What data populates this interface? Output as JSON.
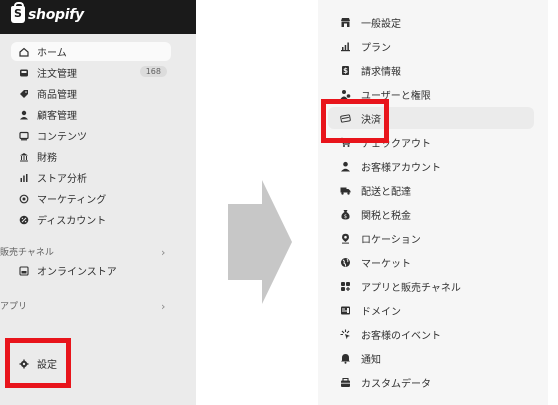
{
  "left_panel": {
    "brand": "shopify",
    "nav": [
      {
        "label": "ホーム",
        "icon": "home-icon"
      },
      {
        "label": "注文管理",
        "icon": "inbox-icon",
        "badge": "168"
      },
      {
        "label": "商品管理",
        "icon": "tag-icon"
      },
      {
        "label": "顧客管理",
        "icon": "person-icon"
      },
      {
        "label": "コンテンツ",
        "icon": "image-icon"
      },
      {
        "label": "財務",
        "icon": "bank-icon"
      },
      {
        "label": "ストア分析",
        "icon": "bar-chart-icon"
      },
      {
        "label": "マーケティング",
        "icon": "target-icon"
      },
      {
        "label": "ディスカウント",
        "icon": "discount-icon"
      }
    ],
    "sales_channels_label": "販売チャネル",
    "online_store_label": "オンラインストア",
    "apps_label": "アプリ",
    "settings_label": "設定"
  },
  "right_panel": {
    "items": [
      {
        "label": "一般設定",
        "icon": "store-icon"
      },
      {
        "label": "プラン",
        "icon": "plan-chart-icon"
      },
      {
        "label": "請求情報",
        "icon": "billing-icon"
      },
      {
        "label": "ユーザーと権限",
        "icon": "users-icon"
      },
      {
        "label": "決済",
        "icon": "payment-icon"
      },
      {
        "label": "チェックアウト",
        "icon": "cart-icon"
      },
      {
        "label": "お客様アカウント",
        "icon": "person-icon"
      },
      {
        "label": "配送と配達",
        "icon": "truck-icon"
      },
      {
        "label": "関税と税金",
        "icon": "money-bag-icon"
      },
      {
        "label": "ロケーション",
        "icon": "location-icon"
      },
      {
        "label": "マーケット",
        "icon": "globe-icon"
      },
      {
        "label": "アプリと販売チャネル",
        "icon": "apps-icon"
      },
      {
        "label": "ドメイン",
        "icon": "domain-icon"
      },
      {
        "label": "お客様のイベント",
        "icon": "sparkle-icon"
      },
      {
        "label": "通知",
        "icon": "bell-icon"
      },
      {
        "label": "カスタムデータ",
        "icon": "database-icon"
      }
    ]
  },
  "colors": {
    "highlight_box": "#e8141b",
    "topbar": "#1a1a1a",
    "arrow": "#c7c7c7"
  }
}
